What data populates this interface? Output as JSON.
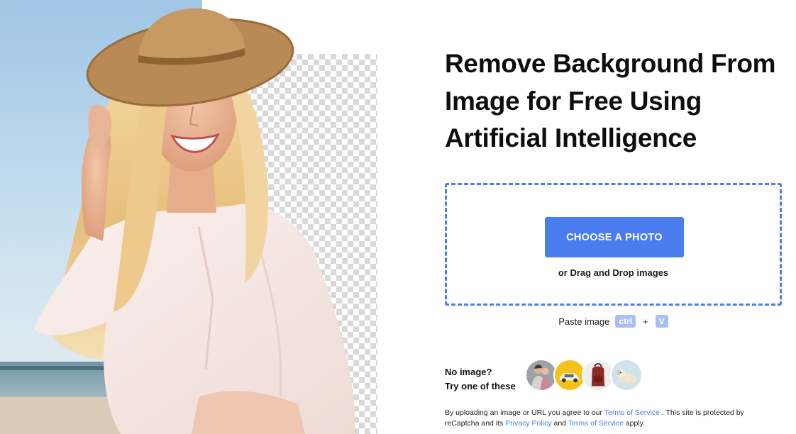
{
  "hero": {
    "illustration": "woman-with-straw-hat-background-removal-demo",
    "background_pattern": "transparency-checkerboard"
  },
  "headline": {
    "line1": "Remove Background From",
    "line2": "Image for Free Using",
    "line3": "Artificial Intelligence"
  },
  "upload": {
    "button_label": "CHOOSE A PHOTO",
    "drag_text": "or Drag and Drop images",
    "border_color": "#4a7cf0",
    "button_color": "#4a7cf0"
  },
  "paste": {
    "label": "Paste image",
    "key1": "ctrl",
    "plus": "+",
    "key2": "V"
  },
  "samples": {
    "prompt_line1": "No image?",
    "prompt_line2": "Try one of these",
    "items": [
      {
        "icon": "couple-photo-sample"
      },
      {
        "icon": "yellow-car-sample"
      },
      {
        "icon": "red-backpack-sample"
      },
      {
        "icon": "puppy-sample"
      }
    ]
  },
  "legal": {
    "text1": "By uploading an image or URL you agree to our ",
    "tos_link": "Terms of Service",
    "text2": " . This site is protected by reCaptcha and its ",
    "privacy_link": "Privacy Policy",
    "text3": " and ",
    "tos_link2": "Terms of Service",
    "text4": " apply."
  }
}
